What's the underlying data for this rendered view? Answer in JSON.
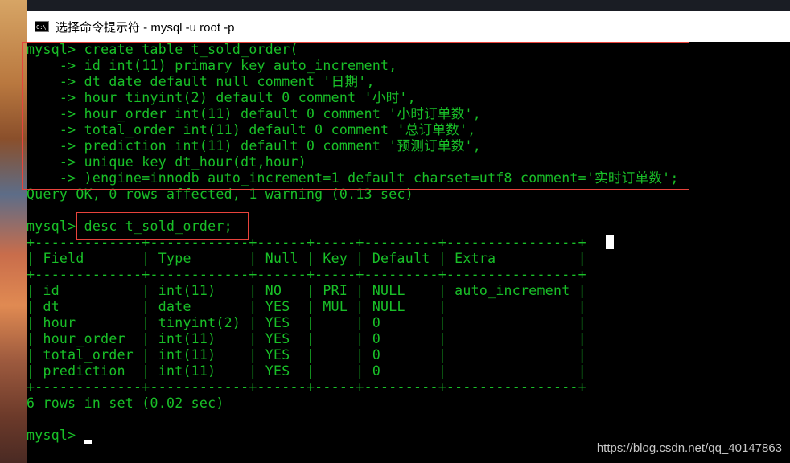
{
  "window": {
    "icon_text": "C:\\",
    "title": "选择命令提示符 - mysql  -u root -p"
  },
  "console": {
    "create_lines": [
      "mysql> create table t_sold_order(",
      "    -> id int(11) primary key auto_increment,",
      "    -> dt date default null comment '日期',",
      "    -> hour tinyint(2) default 0 comment '小时',",
      "    -> hour_order int(11) default 0 comment '小时订单数',",
      "    -> total_order int(11) default 0 comment '总订单数',",
      "    -> prediction int(11) default 0 comment '预测订单数',",
      "    -> unique key dt_hour(dt,hour)",
      "    -> )engine=innodb auto_increment=1 default charset=utf8 comment='实时订单数';"
    ],
    "query_result": "Query OK, 0 rows affected, 1 warning (0.13 sec)",
    "desc_prompt": "mysql> ",
    "desc_command": "desc t_sold_order;",
    "table_border": "+-------------+------------+------+-----+---------+----------------+",
    "table_header": "| Field       | Type       | Null | Key | Default | Extra          |",
    "table_rows": [
      "| id          | int(11)    | NO   | PRI | NULL    | auto_increment |",
      "| dt          | date       | YES  | MUL | NULL    |                |",
      "| hour        | tinyint(2) | YES  |     | 0       |                |",
      "| hour_order  | int(11)    | YES  |     | 0       |                |",
      "| total_order | int(11)    | YES  |     | 0       |                |",
      "| prediction  | int(11)    | YES  |     | 0       |                |"
    ],
    "rows_result": "6 rows in set (0.02 sec)",
    "final_prompt": "mysql> "
  },
  "watermark": "https://blog.csdn.net/qq_40147863",
  "colors": {
    "terminal_text": "#19c028",
    "terminal_bg": "#000000",
    "highlight_box": "#e8433c"
  }
}
